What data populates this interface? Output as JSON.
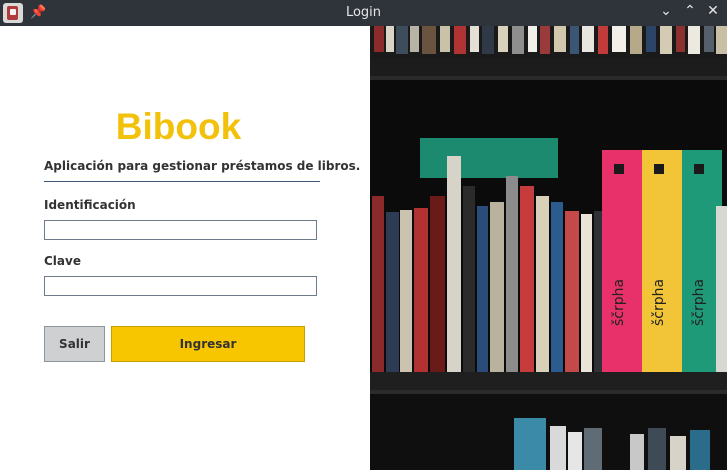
{
  "window": {
    "title": "Login",
    "icons": [
      "app-icon",
      "pin-icon"
    ],
    "controls": [
      "minimize-icon",
      "maximize-icon",
      "close-icon"
    ]
  },
  "form": {
    "brand": "Bibook",
    "subtitle": "Aplicación para gestionar préstamos de libros.",
    "id_label": "Identificación",
    "id_value": "",
    "key_label": "Clave",
    "key_value": "",
    "exit_label": "Salir",
    "login_label": "Ingresar"
  },
  "colors": {
    "brand": "#f2c10b",
    "login_button": "#f7c600",
    "exit_button": "#cfd0d2",
    "titlebar": "#2f343b"
  },
  "image": {
    "description_name": "bookshelf-photo",
    "spine_texts": [
      "ščrpha",
      "ščrpha",
      "ščrpha"
    ]
  }
}
